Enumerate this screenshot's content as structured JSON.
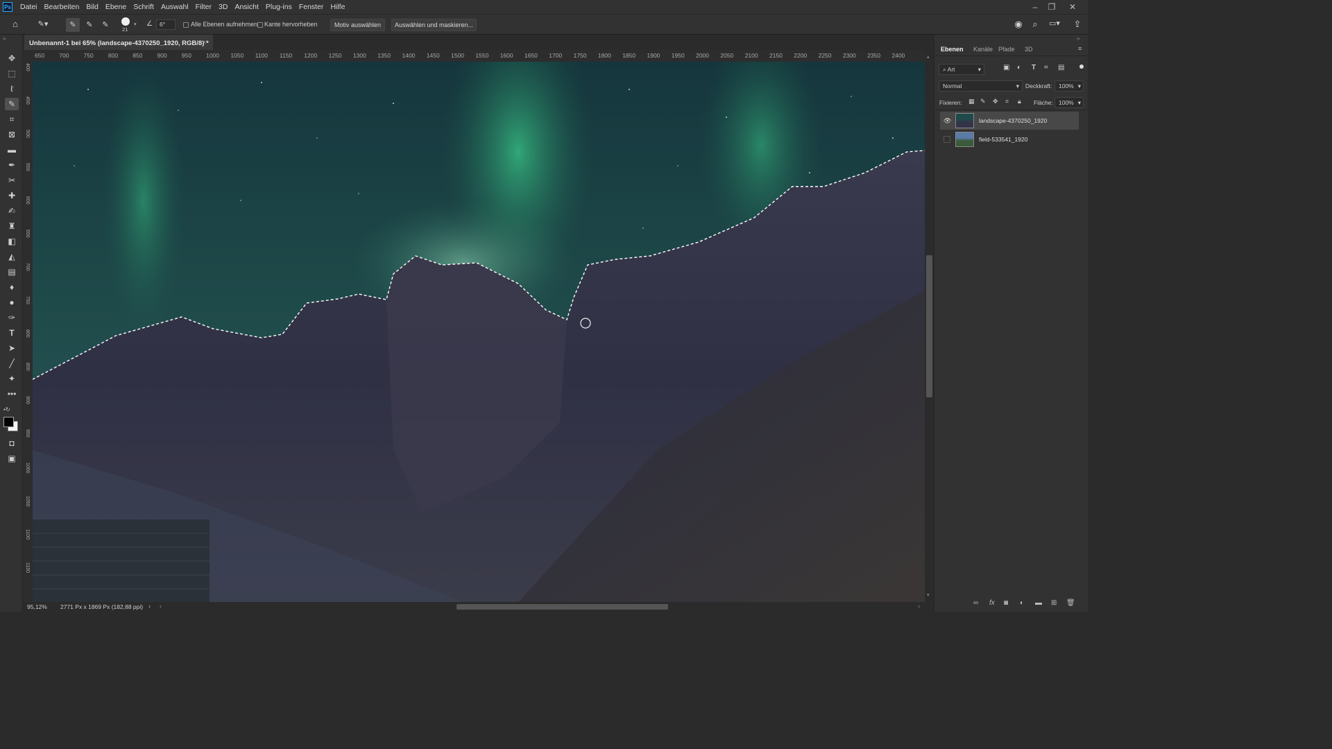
{
  "menubar": {
    "logo": "Ps",
    "items": [
      "Datei",
      "Bearbeiten",
      "Bild",
      "Ebene",
      "Schrift",
      "Auswahl",
      "Filter",
      "3D",
      "Ansicht",
      "Plug-ins",
      "Fenster",
      "Hilfe"
    ]
  },
  "options": {
    "brush_size": "21",
    "angle": "6°",
    "sample_all_layers": "Alle Ebenen aufnehmen",
    "enhance_edge": "Kante hervorheben",
    "select_subject": "Motiv auswählen",
    "select_and_mask": "Auswählen und maskieren..."
  },
  "document": {
    "tab_title": "Unbenannt-1 bei 65% (landscape-4370250_1920, RGB/8) *"
  },
  "ruler": {
    "top": [
      "650",
      "700",
      "750",
      "800",
      "850",
      "900",
      "950",
      "1000",
      "1050",
      "1100",
      "1150",
      "1200",
      "1250",
      "1300",
      "1350",
      "1400",
      "1450",
      "1500",
      "1550",
      "1600",
      "1650",
      "1700",
      "1750",
      "1800",
      "1850",
      "1900",
      "1950",
      "2000",
      "2050",
      "2100",
      "2150",
      "2200",
      "2250",
      "2300",
      "2350",
      "2400"
    ],
    "left": [
      "400",
      "450",
      "500",
      "550",
      "600",
      "650",
      "700",
      "750",
      "800",
      "850",
      "900",
      "950",
      "1000",
      "1050",
      "1100",
      "1150"
    ]
  },
  "status": {
    "zoom": "95,12%",
    "doc_info": "2771 Px x 1869 Px (182,88 ppi)"
  },
  "layers_panel": {
    "tabs": [
      "Ebenen",
      "Kanäle",
      "Pfade",
      "3D"
    ],
    "active_tab": "Ebenen",
    "filter_kind": "Art",
    "blend_mode": "Normal",
    "opacity_label": "Deckkraft:",
    "opacity_value": "100%",
    "lock_label": "Fixieren:",
    "fill_label": "Fläche:",
    "fill_value": "100%",
    "layers": [
      {
        "name": "landscape-4370250_1920",
        "visible": true,
        "selected": true
      },
      {
        "name": "field-533541_1920",
        "visible": false,
        "selected": false
      }
    ]
  },
  "colors": {
    "ui_bg": "#323232",
    "canvas_sky_top": "#173a3e",
    "aurora": "#2fb77a",
    "mountain": "#2e3044",
    "accent": "#31a8ff"
  },
  "icons": {
    "toolbar": [
      "move-icon",
      "marquee-icon",
      "lasso-icon",
      "quick-selection-icon",
      "crop-icon",
      "frame-icon",
      "ruler-icon",
      "eyedropper-icon",
      "healing-icon",
      "bandaid-icon",
      "brush-icon",
      "stamp-icon",
      "history-brush-icon",
      "eraser-icon",
      "gradient-icon",
      "blur-icon",
      "dodge-icon",
      "pen-icon",
      "type-icon",
      "path-select-icon",
      "line-icon",
      "shape-icon",
      "more-icon"
    ]
  }
}
